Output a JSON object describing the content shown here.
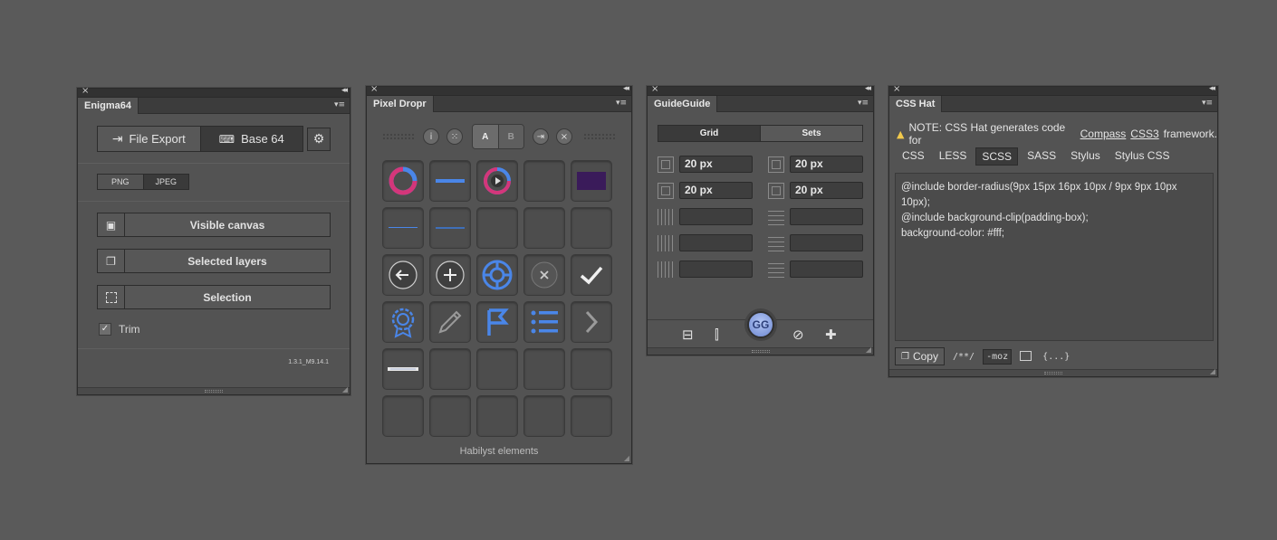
{
  "colors": {
    "background": "#5a5a5a",
    "panel": "#535353",
    "accent_blue": "#4a86e8",
    "accent_pink": "#d4367a",
    "accent_purple": "#3a1b5a"
  },
  "enigma": {
    "title": "Enigma64",
    "file_export": "File Export",
    "base64": "Base 64",
    "format_png": "PNG",
    "format_jpeg": "JPEG",
    "visible_canvas": "Visible canvas",
    "selected_layers": "Selected layers",
    "selection": "Selection",
    "trim": "Trim",
    "version": "1.3.1_M9.14.1"
  },
  "dropr": {
    "title": "Pixel Dropr",
    "tab_a": "A",
    "tab_b": "B",
    "footer": "Habilyst elements",
    "cells": [
      "donut-chart",
      "blue-line",
      "play-donut",
      "empty",
      "purple-rect",
      "thin-line",
      "thin-line",
      "empty",
      "empty",
      "empty",
      "arrow-left-circle",
      "plus-circle",
      "life-ring",
      "close-circle",
      "checkmark",
      "badge",
      "pencil",
      "flag",
      "list",
      "chevron-right",
      "text-strip",
      "empty",
      "empty",
      "empty",
      "empty",
      "empty",
      "empty",
      "empty",
      "empty",
      "empty"
    ]
  },
  "guide": {
    "title": "GuideGuide",
    "tab_grid": "Grid",
    "tab_sets": "Sets",
    "margin_left": "20 px",
    "margin_right": "20 px",
    "margin_top": "20 px",
    "margin_bottom": "20 px",
    "logo": "GG"
  },
  "csshat": {
    "title": "CSS Hat",
    "note_prefix": "NOTE: CSS Hat generates code for",
    "note_link1": "Compass",
    "note_link2": "CSS3",
    "note_suffix": "framework.",
    "tabs": [
      "CSS",
      "LESS",
      "SCSS",
      "SASS",
      "Stylus",
      "Stylus CSS"
    ],
    "active_tab": "SCSS",
    "code_line1": "@include border-radius(9px 15px 16px 10px / 9px 9px 10px 10px);",
    "code_line2": "@include background-clip(padding-box);",
    "code_line3": "background-color: #fff;",
    "copy": "Copy",
    "comment_toggle": "/**/",
    "prefix_toggle": "-moz",
    "braces": "{...}"
  }
}
